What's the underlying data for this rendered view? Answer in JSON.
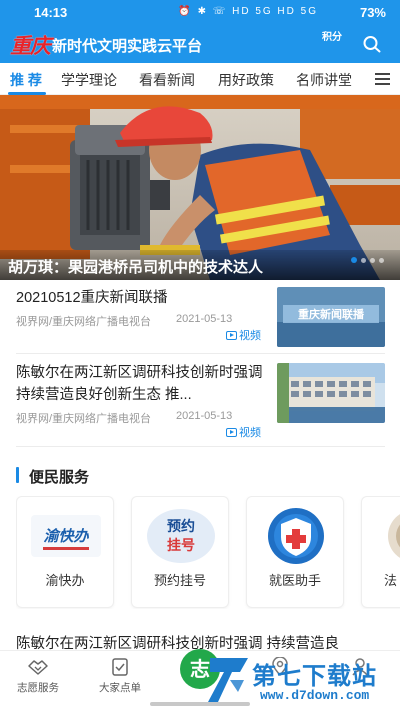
{
  "status_bar": {
    "time": "14:13",
    "icons": "⏰ ✱ ☏ HD 5G HD 5G",
    "battery": "73%"
  },
  "header": {
    "logo": "重庆",
    "title": "新时代文明实践云平台",
    "points_label": "积分",
    "search_icon": "search-icon",
    "bg_color": "#1f95ea",
    "logo_color": "#e8242a"
  },
  "tabs": {
    "items": [
      {
        "label": "推 荐",
        "active": true
      },
      {
        "label": "学学理论",
        "active": false
      },
      {
        "label": "看看新闻",
        "active": false
      },
      {
        "label": "用好政策",
        "active": false
      },
      {
        "label": "名师讲堂",
        "active": false
      }
    ],
    "menu_icon": "menu-icon",
    "accent": "#1a8ae5"
  },
  "banner": {
    "caption": "胡万琪：果园港桥吊司机中的技术达人",
    "slide_count": 4,
    "active_slide": 1
  },
  "news": [
    {
      "title": "20210512重庆新闻联播",
      "source": "视界网/重庆网络广播电视台",
      "date": "2021-05-13",
      "badge": "视频",
      "thumb_text": "重庆新闻联播"
    },
    {
      "title": "陈敏尔在两江新区调研科技创新时强调 持续营造良好创新生态 推...",
      "source": "视界网/重庆网络广播电视台",
      "date": "2021-05-13",
      "badge": "视频"
    }
  ],
  "services": {
    "section_title": "便民服务",
    "items": [
      {
        "label": "渝快办",
        "pic_text": "渝快办"
      },
      {
        "label": "预约挂号",
        "pic_text": "预约挂号"
      },
      {
        "label": "就医助手"
      },
      {
        "label": "法"
      }
    ]
  },
  "bottom_headline": "陈敏尔在两江新区调研科技创新时强调 持续营造良",
  "bottom_nav": {
    "items": [
      {
        "label": "志愿服务",
        "icon": "handshake-icon"
      },
      {
        "label": "大家点单",
        "icon": "checklist-icon"
      },
      {
        "label": "",
        "icon": "home-icon",
        "fab_text": "志"
      },
      {
        "label": "",
        "icon": "location-icon"
      },
      {
        "label": "",
        "icon": "profile-icon"
      }
    ],
    "fab_color": "#22a84a"
  },
  "watermark": {
    "text": "第七下载站",
    "url": "www.d7down.com"
  }
}
